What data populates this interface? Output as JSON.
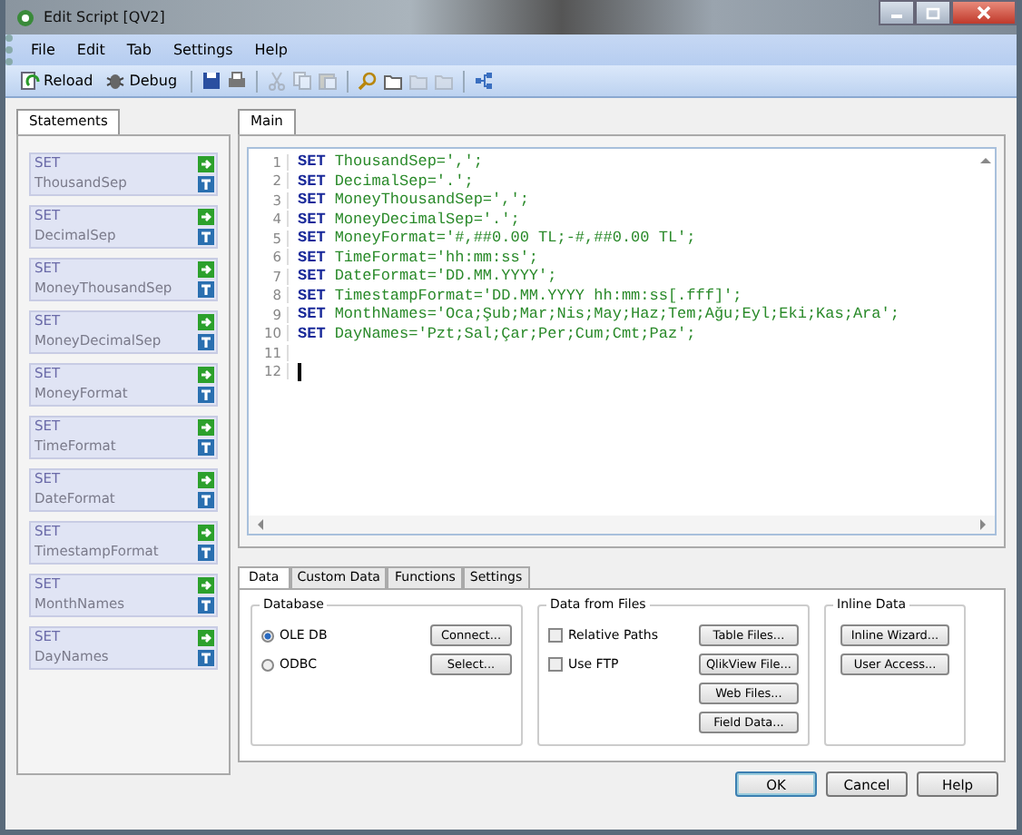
{
  "window": {
    "title": "Edit Script [QV2]"
  },
  "menu": [
    "File",
    "Edit",
    "Tab",
    "Settings",
    "Help"
  ],
  "toolbar": [
    {
      "label": "Reload"
    },
    {
      "label": "Debug"
    }
  ],
  "statements_tab": {
    "label": "Statements",
    "selected": true
  },
  "statements": [
    {
      "keyword": "SET",
      "name": "ThousandSep"
    },
    {
      "keyword": "SET",
      "name": "DecimalSep"
    },
    {
      "keyword": "SET",
      "name": "MoneyThousandSep"
    },
    {
      "keyword": "SET",
      "name": "MoneyDecimalSep"
    },
    {
      "keyword": "SET",
      "name": "MoneyFormat"
    },
    {
      "keyword": "SET",
      "name": "TimeFormat"
    },
    {
      "keyword": "SET",
      "name": "DateFormat"
    },
    {
      "keyword": "SET",
      "name": "TimestampFormat"
    },
    {
      "keyword": "SET",
      "name": "MonthNames"
    },
    {
      "keyword": "SET",
      "name": "DayNames"
    }
  ],
  "script_tabs": [
    {
      "label": "Main",
      "selected": true
    }
  ],
  "script_lines": [
    {
      "number": "1",
      "keyword": "SET",
      "text": "ThousandSep=',';"
    },
    {
      "number": "2",
      "keyword": "SET",
      "text": "DecimalSep='.';"
    },
    {
      "number": "3",
      "keyword": "SET",
      "text": "MoneyThousandSep=',';"
    },
    {
      "number": "4",
      "keyword": "SET",
      "text": "MoneyDecimalSep='.';"
    },
    {
      "number": "5",
      "keyword": "SET",
      "text": "MoneyFormat='#,##0.00 TL;-#,##0.00 TL';"
    },
    {
      "number": "6",
      "keyword": "SET",
      "text": "TimeFormat='hh:mm:ss';"
    },
    {
      "number": "7",
      "keyword": "SET",
      "text": "DateFormat='DD.MM.YYYY';"
    },
    {
      "number": "8",
      "keyword": "SET",
      "text": "TimestampFormat='DD.MM.YYYY hh:mm:ss[.fff]';"
    },
    {
      "number": "9",
      "keyword": "SET",
      "text": "MonthNames='Oca;Şub;Mar;Nis;May;Haz;Tem;Ağu;Eyl;Eki;Kas;Ara';"
    },
    {
      "number": "10",
      "keyword": "SET",
      "text": "DayNames='Pzt;Sal;Çar;Per;Cum;Cmt;Paz';"
    },
    {
      "number": "11",
      "cursor": false
    },
    {
      "number": "12",
      "cursor": true
    }
  ],
  "bottom_tabs": [
    {
      "label": "Data",
      "selected": true
    },
    {
      "label": "Custom Data",
      "selected": false
    },
    {
      "label": "Functions",
      "selected": false
    },
    {
      "label": "Settings",
      "selected": false
    }
  ],
  "database": {
    "title": "Database",
    "options": [
      {
        "label": "OLE DB",
        "selected": true
      },
      {
        "label": "ODBC",
        "selected": false
      }
    ],
    "buttons": [
      "Connect...",
      "Select..."
    ]
  },
  "data_from_files": {
    "title": "Data from Files",
    "checkboxes": [
      {
        "label": "Relative Paths",
        "checked": false
      },
      {
        "label": "Use FTP",
        "checked": false
      }
    ],
    "buttons": [
      "Table Files...",
      "QlikView File...",
      "Web Files...",
      "Field Data..."
    ]
  },
  "inline_data": {
    "title": "Inline Data",
    "buttons": [
      "Inline Wizard...",
      "User Access..."
    ]
  },
  "dialog_buttons": [
    "OK",
    "Cancel",
    "Help"
  ]
}
